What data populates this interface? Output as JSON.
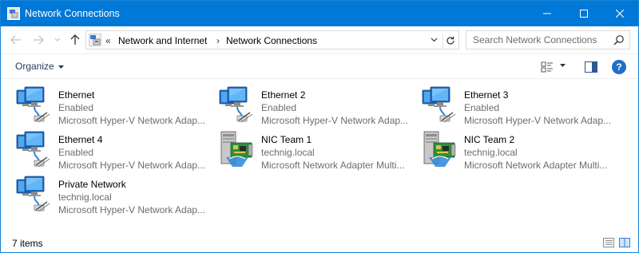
{
  "window": {
    "title": "Network Connections",
    "icon": "network-connections-icon"
  },
  "address": {
    "prefix": "«",
    "crumbs": [
      "Network and Internet",
      "Network Connections"
    ],
    "separator": "›"
  },
  "search": {
    "placeholder": "Search Network Connections"
  },
  "toolbar": {
    "organize_label": "Organize",
    "help_label": "?"
  },
  "connections": [
    {
      "name": "Ethernet",
      "status": "Enabled",
      "device": "Microsoft Hyper-V Network Adap...",
      "icon": "ethernet-adapter-icon"
    },
    {
      "name": "Ethernet 2",
      "status": "Enabled",
      "device": "Microsoft Hyper-V Network Adap...",
      "icon": "ethernet-adapter-icon"
    },
    {
      "name": "Ethernet 3",
      "status": "Enabled",
      "device": "Microsoft Hyper-V Network Adap...",
      "icon": "ethernet-adapter-icon"
    },
    {
      "name": "Ethernet 4",
      "status": "Enabled",
      "device": "Microsoft Hyper-V Network Adap...",
      "icon": "ethernet-adapter-icon"
    },
    {
      "name": "NIC Team 1",
      "status": "technig.local",
      "device": "Microsoft Network Adapter Multi...",
      "icon": "nic-team-icon"
    },
    {
      "name": "NIC Team 2",
      "status": "technig.local",
      "device": "Microsoft Network Adapter Multi...",
      "icon": "nic-team-icon"
    },
    {
      "name": "Private Network",
      "status": "technig.local",
      "device": "Microsoft Hyper-V Network Adap...",
      "icon": "ethernet-adapter-icon"
    }
  ],
  "statusbar": {
    "count": "7 items"
  },
  "colors": {
    "titlebar": "#0078d7",
    "secondary_text": "#6d6d6d",
    "help": "#1e6fc8"
  }
}
